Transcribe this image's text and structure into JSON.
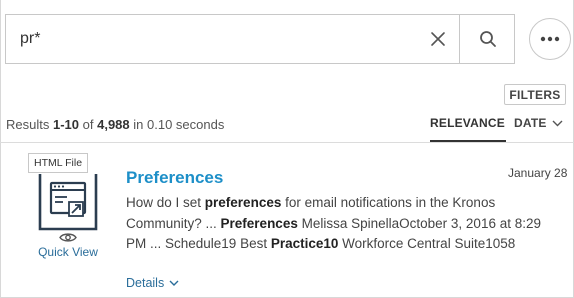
{
  "search": {
    "query": "pr*"
  },
  "toolbar": {
    "filters_label": "FILTERS"
  },
  "results_summary": {
    "prefix": "Results",
    "range": "1-10",
    "of_label": "of",
    "total": "4,988",
    "timing": "in 0.10 seconds"
  },
  "sort": {
    "relevance_label": "RELEVANCE",
    "date_label": "DATE"
  },
  "results": [
    {
      "filetype": "HTML File",
      "title": "Preferences",
      "date": "January 28",
      "excerpt_parts": [
        {
          "t": "How do I set ",
          "b": false
        },
        {
          "t": "preferences",
          "b": true
        },
        {
          "t": " for email notifications in the Kronos Community? ... ",
          "b": false
        },
        {
          "t": "Preferences",
          "b": true
        },
        {
          "t": " Melissa SpinellaOctober 3, 2016 at 8:29 PM ... Schedule19 Best ",
          "b": false
        },
        {
          "t": "Practice10",
          "b": true
        },
        {
          "t": " Workforce Central Suite1058",
          "b": false
        }
      ],
      "quick_view_label": "Quick View",
      "details_label": "Details"
    }
  ],
  "colors": {
    "accent": "#1d8fc8",
    "link": "#2a6d9a",
    "icon": "#2b3d50"
  },
  "icons": {
    "clear": "close-icon",
    "search": "search-icon",
    "more": "more-horizontal-icon",
    "sort": "chevron-down-icon",
    "document": "html-document-icon",
    "quick_view": "eye-icon"
  }
}
